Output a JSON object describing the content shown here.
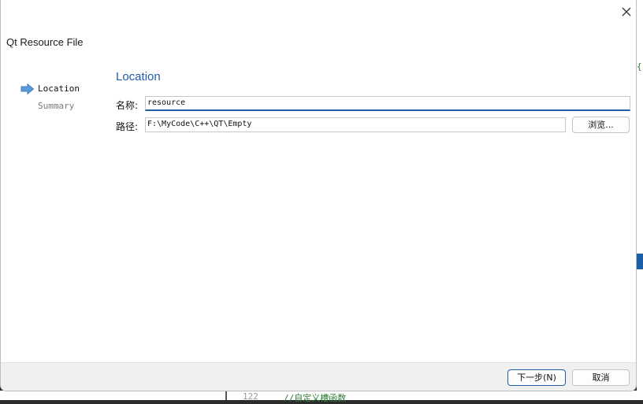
{
  "window": {
    "title": "Qt Resource File"
  },
  "sidebar": {
    "items": [
      {
        "label": "Location",
        "active": true
      },
      {
        "label": "Summary",
        "active": false
      }
    ]
  },
  "page": {
    "title": "Location",
    "name_label": "名称:",
    "name_value": "resource",
    "path_label": "路径:",
    "path_value": "F:\\MyCode\\C++\\QT\\Empty",
    "browse_label": "浏览..."
  },
  "footer": {
    "next_label": "下一步(N)",
    "cancel_label": "取消"
  },
  "background_editor": {
    "brace": "{",
    "line_number": "122",
    "comment": "//自定义槽函数"
  },
  "colors": {
    "accent": "#1f5da8",
    "arrow": "#5b9bd5"
  },
  "icons": {
    "close": "close-icon",
    "current_step": "arrow-right-icon"
  }
}
